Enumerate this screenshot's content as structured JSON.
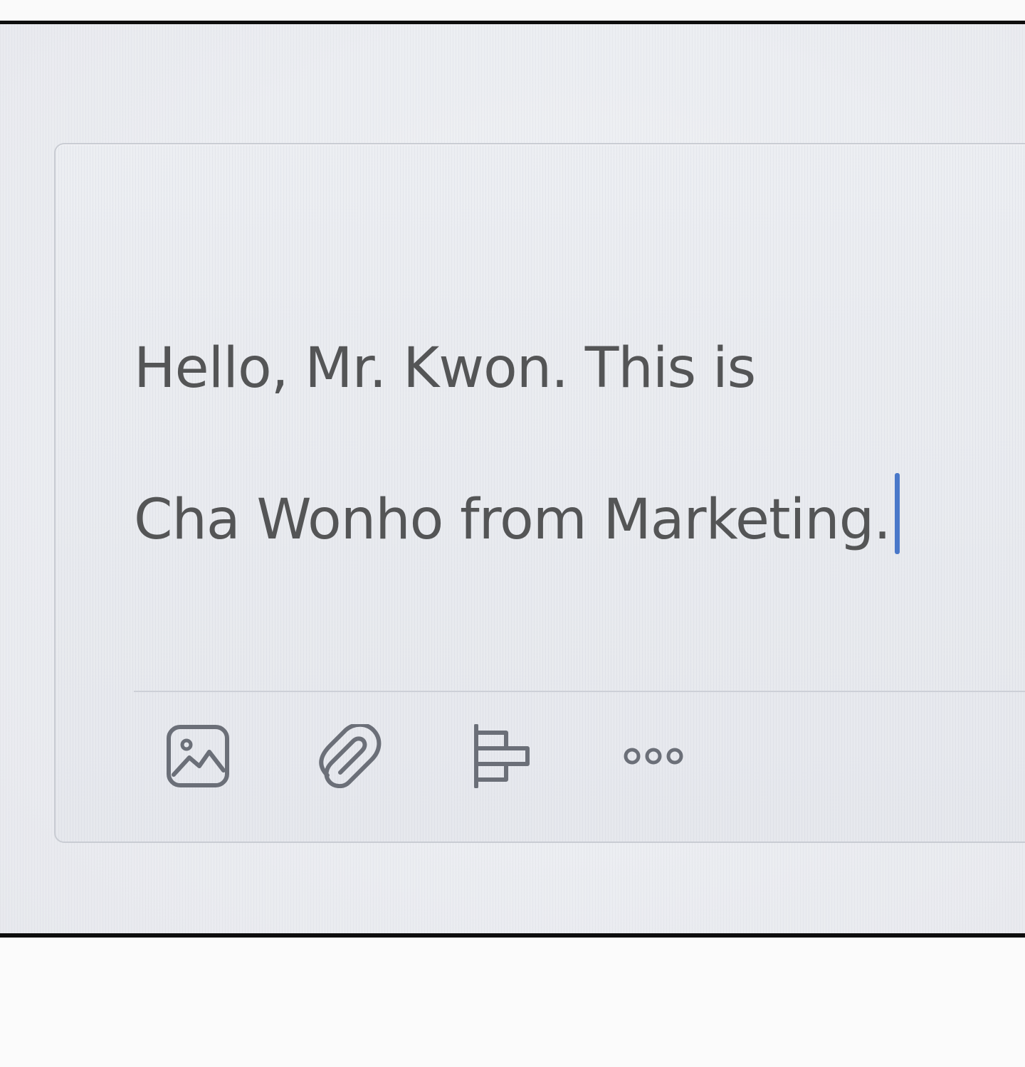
{
  "compose": {
    "message_line_1": "Hello, Mr. Kwon. This is",
    "message_line_2": "Cha Wonho from Marketing."
  },
  "toolbar": {
    "items": [
      {
        "icon": "image-icon"
      },
      {
        "icon": "paperclip-icon"
      },
      {
        "icon": "text-format-icon"
      },
      {
        "icon": "more-options-icon"
      }
    ]
  },
  "colors": {
    "text": "#545556",
    "caret": "#4a78c9",
    "icon_stroke": "#6b6f78",
    "panel_border": "#0e0e0e"
  }
}
